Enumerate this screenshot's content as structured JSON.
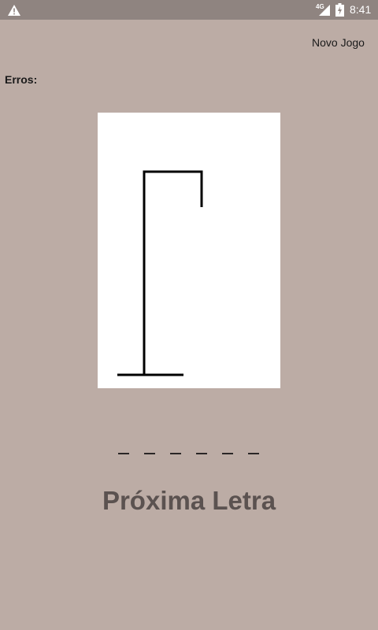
{
  "status_bar": {
    "time": "8:41",
    "network": "4G",
    "icons": [
      "warning-icon",
      "signal-icon",
      "battery-charging-icon"
    ]
  },
  "toolbar": {
    "new_game": "Novo Jogo"
  },
  "game": {
    "errors_label": "Erros:",
    "errors": "",
    "word_slots": [
      "",
      "",
      "",
      "",
      "",
      ""
    ],
    "next_letter": "Próxima Letra"
  }
}
